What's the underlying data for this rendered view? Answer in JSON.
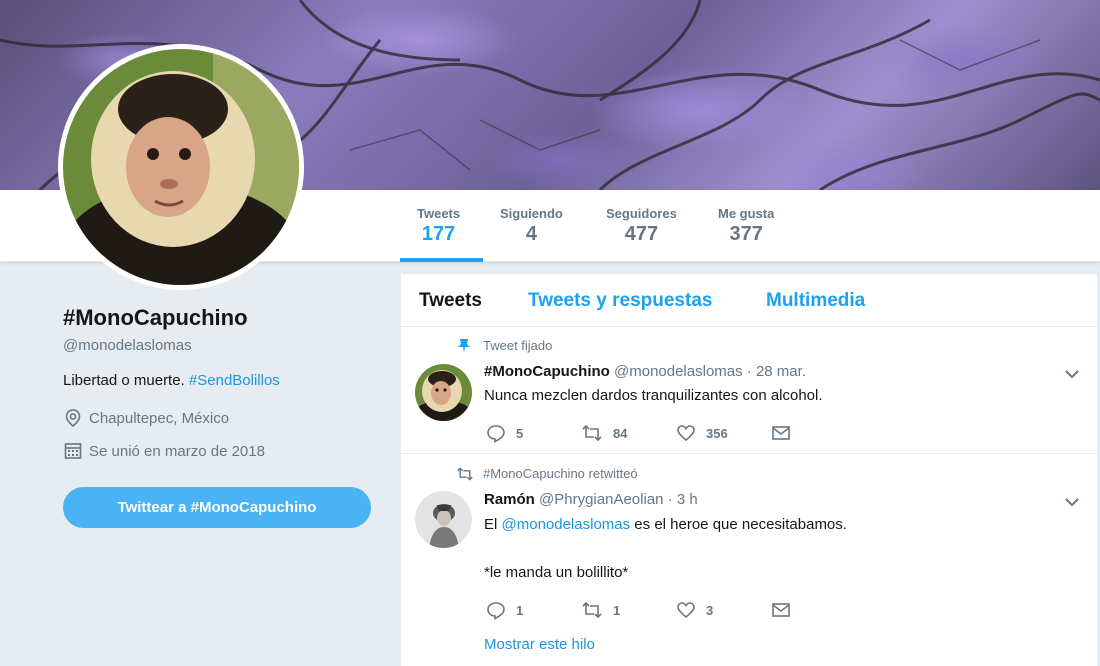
{
  "profile": {
    "name": "#MonoCapuchino",
    "handle": "@monodelaslomas",
    "bio_text": "Libertad o muerte. ",
    "bio_hashtag": "#SendBolillos",
    "location": "Chapultepec, México",
    "joined": "Se unió en marzo de 2018",
    "tweet_to_label": "Twittear a #MonoCapuchino"
  },
  "stats": [
    {
      "label": "Tweets",
      "value": "177"
    },
    {
      "label": "Siguiendo",
      "value": "4"
    },
    {
      "label": "Seguidores",
      "value": "477"
    },
    {
      "label": "Me gusta",
      "value": "377"
    }
  ],
  "tabs": [
    "Tweets",
    "Tweets y respuestas",
    "Multimedia"
  ],
  "tweets": [
    {
      "context": "Tweet fijado",
      "context_icon": "pin-icon",
      "name": "#MonoCapuchino",
      "handle": "@monodelaslomas",
      "time": "· 28 mar.",
      "text": "Nunca mezclen dardos tranquilizantes con alcohol.",
      "replies": "5",
      "retweets": "84",
      "likes": "356"
    },
    {
      "context": "#MonoCapuchino retwitteó",
      "context_icon": "retweet-icon",
      "name": "Ramón",
      "handle": "@PhrygianAeolian",
      "time": "· 3 h",
      "text_pre": "El ",
      "text_mention": "@monodelaslomas",
      "text_post": " es el heroe que necesitabamos.",
      "text_line2": "*le manda un bolillito*",
      "replies": "1",
      "retweets": "1",
      "likes": "3",
      "show_thread": "Mostrar este hilo"
    }
  ],
  "colors": {
    "accent": "#1da1f2",
    "button": "#4ab3f4",
    "muted": "#657786",
    "background": "#e6ecf0"
  }
}
